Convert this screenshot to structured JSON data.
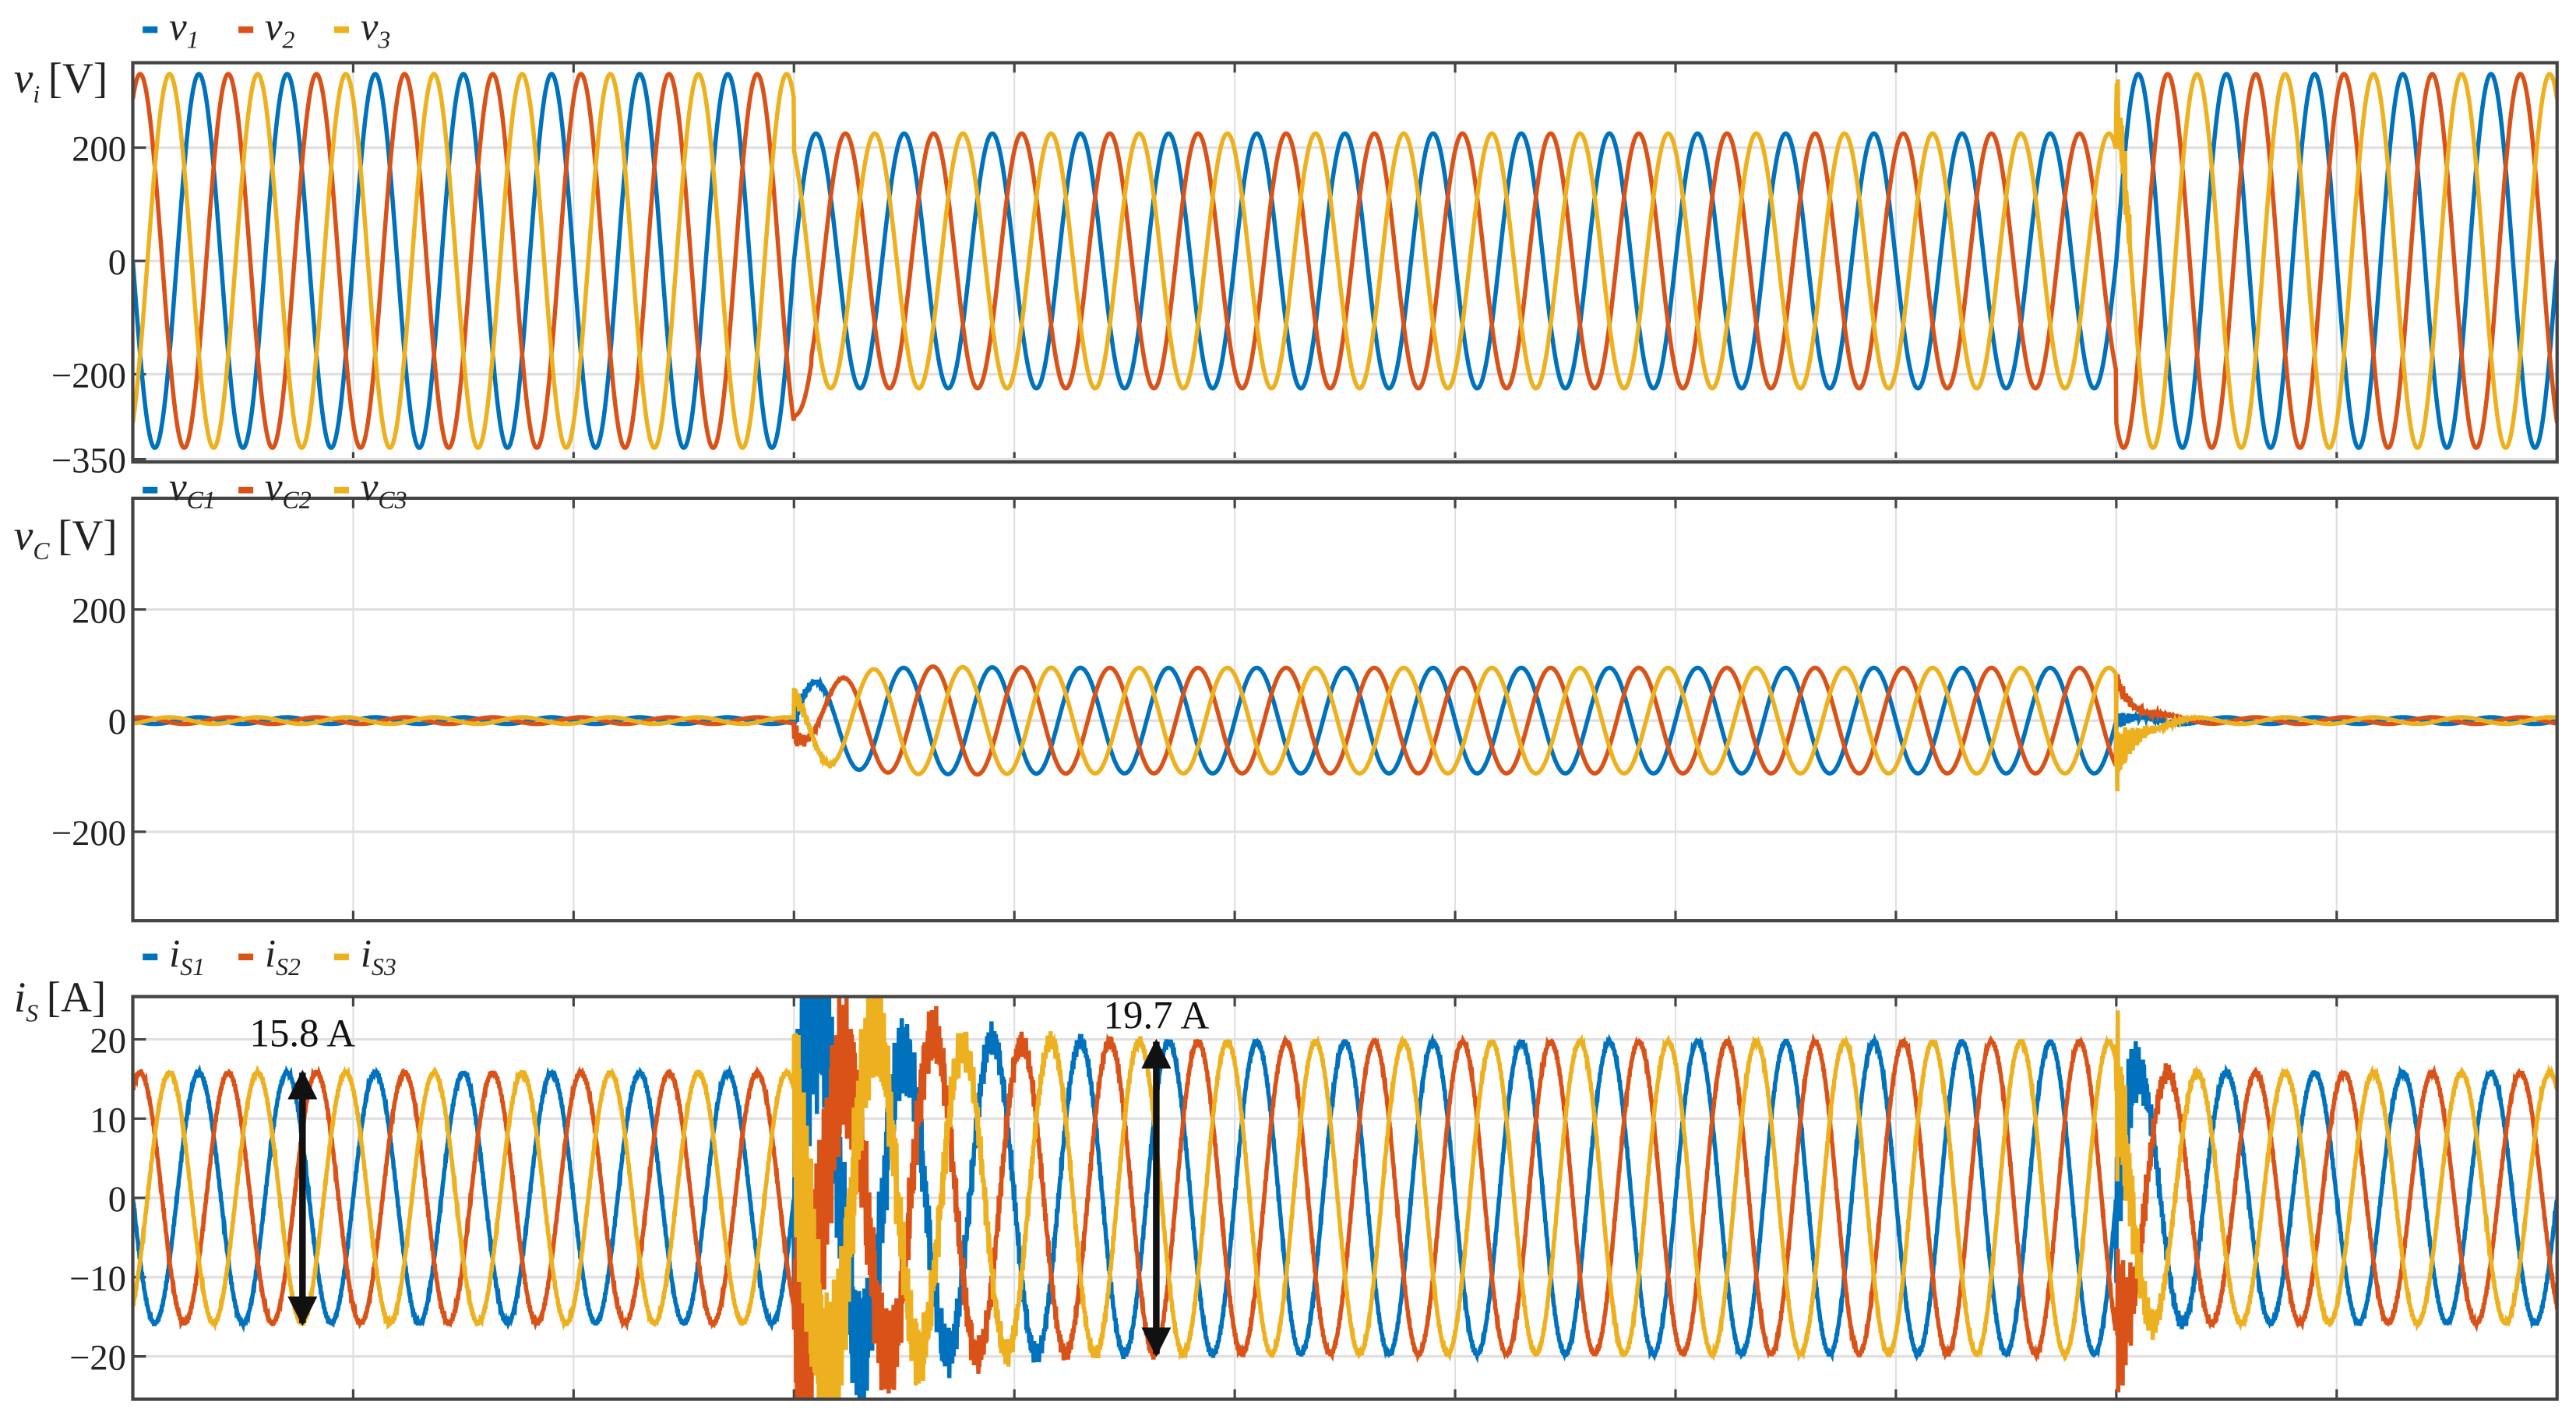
{
  "colors": {
    "s1": "#0072BD",
    "s2": "#D95319",
    "s3": "#EDB120",
    "grid": "#e0e0e0",
    "axis": "#444444"
  },
  "chart_data": [
    {
      "type": "line",
      "ylabel_main": "v",
      "ylabel_sub": "i",
      "ylabel_unit": "[V]",
      "legend": [
        {
          "main": "v",
          "sub": "1"
        },
        {
          "main": "v",
          "sub": "2"
        },
        {
          "main": "v",
          "sub": "3"
        }
      ],
      "legend_placement": "top-left",
      "yticks": [
        200,
        0,
        -200,
        -350
      ],
      "ytick_labels": [
        "200",
        "0",
        "−200",
        "−350"
      ],
      "ylim": [
        -355,
        350
      ],
      "xlim": [
        0,
        0.55
      ],
      "frequency_hz": 50,
      "amplitude_segments": [
        {
          "from": 0,
          "to": 0.15,
          "amplitude": 330
        },
        {
          "from": 0.15,
          "to": 0.45,
          "amplitude": 225
        },
        {
          "from": 0.45,
          "to": 0.55,
          "amplitude": 330
        }
      ],
      "grid": true
    },
    {
      "type": "line",
      "ylabel_main": "v",
      "ylabel_sub": "C",
      "ylabel_unit": "[V]",
      "legend": [
        {
          "main": "v",
          "sub": "C1"
        },
        {
          "main": "v",
          "sub": "C2"
        },
        {
          "main": "v",
          "sub": "C3"
        }
      ],
      "legend_placement": "top-left",
      "yticks": [
        200,
        0,
        -200
      ],
      "ytick_labels": [
        "200",
        "0",
        "−200"
      ],
      "ylim": [
        -360,
        400
      ],
      "xlim": [
        0,
        0.55
      ],
      "frequency_hz": 50,
      "amplitude_segments": [
        {
          "from": 0,
          "to": 0.15,
          "amplitude": 6
        },
        {
          "from": 0.15,
          "to": 0.45,
          "amplitude": 95
        },
        {
          "from": 0.45,
          "to": 0.55,
          "amplitude": 6
        }
      ],
      "transient_peak": 160,
      "grid": true
    },
    {
      "type": "line",
      "ylabel_main": "i",
      "ylabel_sub": "S",
      "ylabel_unit": "[A]",
      "legend": [
        {
          "main": "i",
          "sub": "S1"
        },
        {
          "main": "i",
          "sub": "S2"
        },
        {
          "main": "i",
          "sub": "S3"
        }
      ],
      "legend_placement": "top-left",
      "yticks": [
        20,
        10,
        0,
        -10,
        -20
      ],
      "ytick_labels": [
        "20",
        "10",
        "0",
        "−10",
        "−20"
      ],
      "ylim": [
        -25.4,
        25.4
      ],
      "xlim": [
        0,
        0.55
      ],
      "frequency_hz": 50,
      "amplitude_segments": [
        {
          "from": 0,
          "to": 0.15,
          "amplitude": 15.8
        },
        {
          "from": 0.15,
          "to": 0.45,
          "amplitude": 19.7
        },
        {
          "from": 0.45,
          "to": 0.55,
          "amplitude": 15.8
        }
      ],
      "annotations": [
        {
          "label": "15.8 A",
          "t": 0.0385,
          "from": 15.8,
          "to": -15.8
        },
        {
          "label": "19.7 A",
          "t": 0.2322,
          "from": 19.7,
          "to": -19.7
        }
      ],
      "grid": true
    }
  ]
}
